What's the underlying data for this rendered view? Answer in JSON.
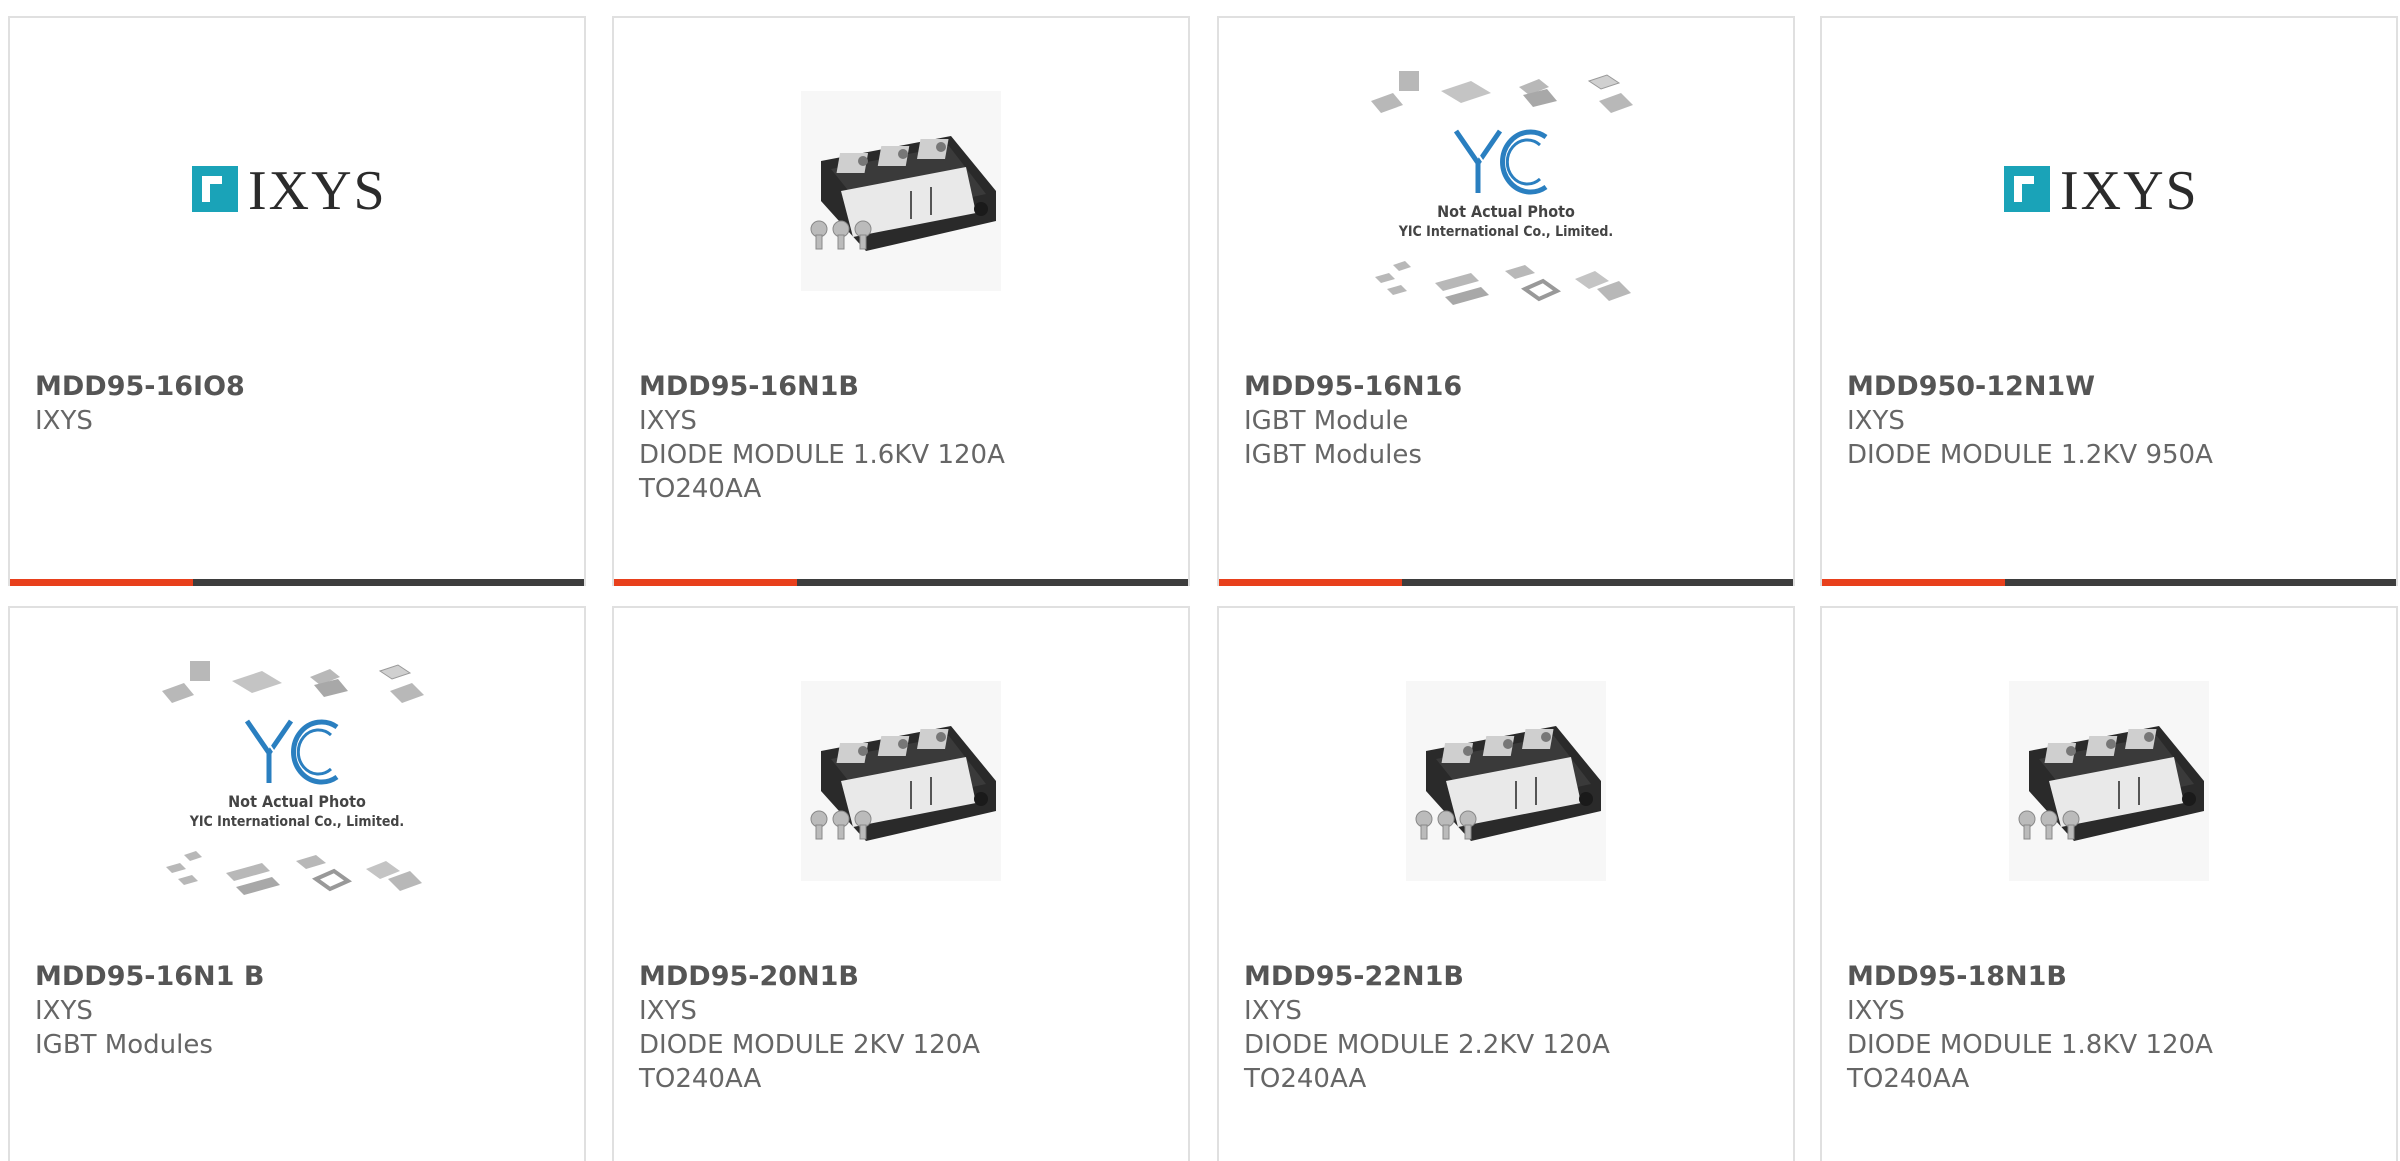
{
  "colors": {
    "accent": "#e8401c",
    "bar": "#3d3d3d",
    "brand_ixys": "#1aa3b8",
    "yic_blue": "#2a7fc0"
  },
  "products": [
    {
      "part": "MDD95-16IO8",
      "lines": [
        "IXYS"
      ],
      "image": "ixys-logo"
    },
    {
      "part": "MDD95-16N1B",
      "lines": [
        "IXYS",
        "DIODE MODULE 1.6KV 120A",
        "TO240AA"
      ],
      "image": "diode-module-photo"
    },
    {
      "part": "MDD95-16N16",
      "lines": [
        "IGBT Module",
        "IGBT Modules"
      ],
      "image": "not-actual-photo",
      "placeholder_text": [
        "Not Actual Photo",
        "YIC International Co., Limited."
      ]
    },
    {
      "part": "MDD950-12N1W",
      "lines": [
        "IXYS",
        "DIODE MODULE 1.2KV 950A"
      ],
      "image": "ixys-logo"
    },
    {
      "part": "MDD95-16N1 B",
      "lines": [
        "IXYS",
        "IGBT Modules"
      ],
      "image": "not-actual-photo",
      "placeholder_text": [
        "Not Actual Photo",
        "YIC International Co., Limited."
      ]
    },
    {
      "part": "MDD95-20N1B",
      "lines": [
        "IXYS",
        "DIODE MODULE 2KV 120A",
        "TO240AA"
      ],
      "image": "diode-module-photo"
    },
    {
      "part": "MDD95-22N1B",
      "lines": [
        "IXYS",
        "DIODE MODULE 2.2KV 120A",
        "TO240AA"
      ],
      "image": "diode-module-photo"
    },
    {
      "part": "MDD95-18N1B",
      "lines": [
        "IXYS",
        "DIODE MODULE 1.8KV 120A",
        "TO240AA"
      ],
      "image": "diode-module-photo"
    }
  ]
}
